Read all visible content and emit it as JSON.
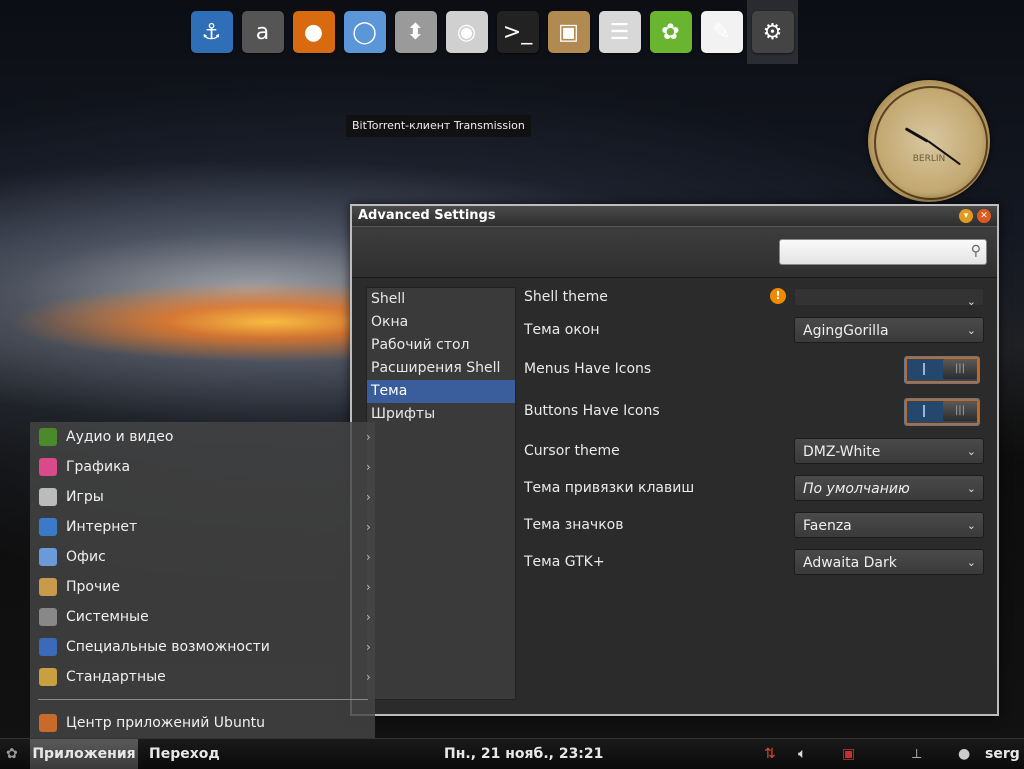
{
  "dock": {
    "items": [
      {
        "icon": "anchor-icon",
        "glyph": "⚓",
        "color": "#2f6fb8"
      },
      {
        "icon": "amazon-icon",
        "glyph": "a",
        "color": "#555"
      },
      {
        "icon": "firefox-icon",
        "glyph": "●",
        "color": "#d86a10"
      },
      {
        "icon": "chromium-icon",
        "glyph": "◯",
        "color": "#5a96d8"
      },
      {
        "icon": "transmission-icon",
        "glyph": "⬍",
        "color": "#9a9a9a"
      },
      {
        "icon": "camera-icon",
        "glyph": "◉",
        "color": "#d0d0d0"
      },
      {
        "icon": "terminal-icon",
        "glyph": ">_",
        "color": "#222"
      },
      {
        "icon": "archive-manager-icon",
        "glyph": "▣",
        "color": "#b08a50"
      },
      {
        "icon": "file-cabinet-icon",
        "glyph": "☰",
        "color": "#d8d8d8"
      },
      {
        "icon": "ubuntu-icon",
        "glyph": "✿",
        "color": "#6ab530"
      },
      {
        "icon": "text-editor-icon",
        "glyph": "✎",
        "color": "#f2f2f2"
      },
      {
        "icon": "settings-icon",
        "glyph": "⚙",
        "color": "#444"
      }
    ]
  },
  "tooltip": "BitTorrent-клиент Transmission",
  "clock": {
    "label": "BERLIN"
  },
  "window": {
    "title": "Advanced Settings",
    "search": {
      "placeholder": ""
    },
    "sidebar": [
      "Shell",
      "Окна",
      "Рабочий стол",
      "Расширения Shell",
      "Тема",
      "Шрифты"
    ],
    "selected_sidebar": "Тема",
    "settings": [
      {
        "label": "Shell theme",
        "type": "combo",
        "value": "",
        "disabled": true,
        "warning": "!"
      },
      {
        "label": "Тема окон",
        "type": "combo",
        "value": "AgingGorilla"
      },
      {
        "label": "Menus Have Icons",
        "type": "switch",
        "value": "off"
      },
      {
        "label": "Buttons Have Icons",
        "type": "switch",
        "value": "off"
      },
      {
        "label": "Cursor theme",
        "type": "combo",
        "value": "DMZ-White"
      },
      {
        "label": "Тема привязки клавиш",
        "type": "combo",
        "value": "По умолчанию",
        "italic": true
      },
      {
        "label": "Тема значков",
        "type": "combo",
        "value": "Faenza"
      },
      {
        "label": "Тема GTK+",
        "type": "combo",
        "value": "Adwaita Dark"
      }
    ]
  },
  "menu": {
    "items": [
      {
        "label": "Аудио и видео",
        "icon": "audio-video-icon",
        "color": "#4a8a2a"
      },
      {
        "label": "Графика",
        "icon": "graphics-icon",
        "color": "#d84a8a"
      },
      {
        "label": "Игры",
        "icon": "games-icon",
        "color": "#bbbbbb"
      },
      {
        "label": "Интернет",
        "icon": "internet-icon",
        "color": "#3a7ac8"
      },
      {
        "label": "Офис",
        "icon": "office-icon",
        "color": "#6a9ad8"
      },
      {
        "label": "Прочие",
        "icon": "other-icon",
        "color": "#c89a4a"
      },
      {
        "label": "Системные",
        "icon": "system-icon",
        "color": "#888888"
      },
      {
        "label": "Специальные возможности",
        "icon": "accessibility-icon",
        "color": "#3a6ab8"
      },
      {
        "label": "Стандартные",
        "icon": "accessories-icon",
        "color": "#c8a040"
      }
    ],
    "footer": {
      "label": "Центр приложений Ubuntu",
      "icon": "software-center-icon",
      "color": "#c86a2a"
    }
  },
  "panel": {
    "apps_label": "Приложения",
    "places_label": "Переход",
    "datetime": "Пн., 21 нояб., 23:21",
    "user": "serg"
  }
}
